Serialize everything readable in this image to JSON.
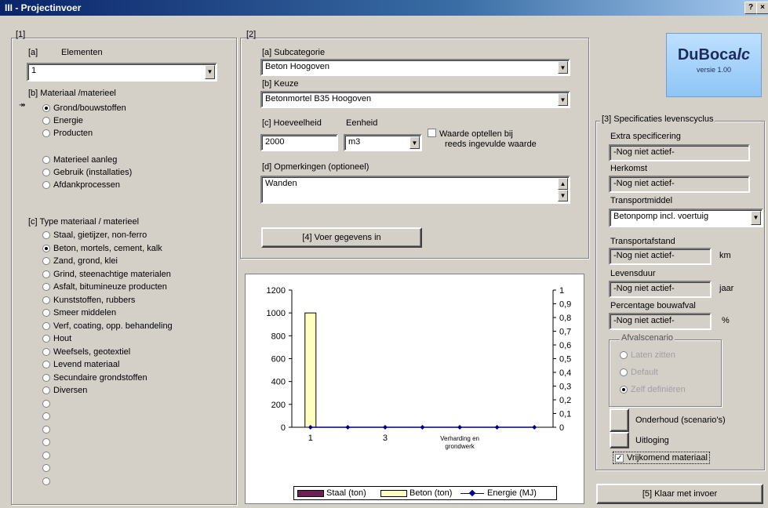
{
  "window": {
    "title": "III - Projectinvoer",
    "help_btn": "?",
    "close_btn": "×"
  },
  "left": {
    "section": "[1]",
    "elements": {
      "label_a": "[a]",
      "label": "Elementen",
      "value": "1"
    },
    "materiaal": {
      "label": "[b]  Materiaal /materieel",
      "options": [
        "Grond/bouwstoffen",
        "Energie",
        "Producten"
      ],
      "options2": [
        "Materieel aanleg",
        "Gebruik (installaties)",
        "Afdankprocessen"
      ],
      "selected": "Grond/bouwstoffen"
    },
    "type": {
      "label": "[c] Type materiaal / materieel",
      "options": [
        "Staal, gietijzer, non-ferro",
        "Beton, mortels, cement, kalk",
        "Zand, grond, klei",
        "Grind, steenachtige materialen",
        "Asfalt, bitumineuze producten",
        "Kunststoffen, rubbers",
        "Smeer middelen",
        "Verf, coating, opp. behandeling",
        "Hout",
        "Weefsels, geotextiel",
        "Levend materiaal",
        "Secundaire grondstoffen",
        "Diversen",
        "",
        "",
        "",
        "",
        "",
        "",
        ""
      ],
      "selected_index": 1
    }
  },
  "mid": {
    "section": "[2]",
    "subcategorie": {
      "label": "[a] Subcategorie",
      "value": "Beton Hoogoven"
    },
    "keuze": {
      "label": "[b] Keuze",
      "value": "Betonmortel B35 Hoogoven"
    },
    "hoeveelheid": {
      "label": "[c] Hoeveelheid",
      "value": "2000"
    },
    "eenheid": {
      "label": "Eenheid",
      "value": "m3"
    },
    "optellen": {
      "label1": "Waarde optellen bij",
      "label2": "reeds ingevulde waarde",
      "checked": false
    },
    "opmerkingen": {
      "label": "[d] Opmerkingen (optioneel)",
      "value": "Wanden"
    },
    "voer_in_button": "[4] Voer gegevens in"
  },
  "chart_data": {
    "type": "bar",
    "categories": [
      "1",
      "2",
      "3",
      "4",
      "5",
      "6",
      "7"
    ],
    "category_tick_labels": [
      "1",
      "",
      "3",
      "",
      "Verharding en\ngrondwerk",
      "",
      ""
    ],
    "series": [
      {
        "name": "Staal (ton)",
        "type": "bar",
        "axis": "left",
        "values": [
          0,
          0,
          0,
          0,
          0,
          0,
          0
        ],
        "color": "#6b1f56"
      },
      {
        "name": "Beton (ton)",
        "type": "bar",
        "axis": "left",
        "values": [
          1000,
          0,
          0,
          0,
          0,
          0,
          0
        ],
        "color": "#ffffc0"
      },
      {
        "name": "Energie (MJ)",
        "type": "line",
        "axis": "right",
        "values": [
          0,
          0,
          0,
          0,
          0,
          0,
          0
        ],
        "color": "#000080"
      }
    ],
    "ylim": [
      0,
      1200
    ],
    "yticks": [
      "0",
      "200",
      "400",
      "600",
      "800",
      "1000",
      "1200"
    ],
    "y2lim": [
      0,
      1
    ],
    "y2ticks": [
      "0",
      "0,1",
      "0,2",
      "0,3",
      "0,4",
      "0,5",
      "0,6",
      "0,7",
      "0,8",
      "0,9",
      "1"
    ],
    "legend_position": "bottom"
  },
  "right": {
    "logo_title_a": "DuBoca",
    "logo_title_b": "lc",
    "logo_version": "versie 1.00",
    "spec_label": "[3] Specificaties levenscyclus",
    "extra": {
      "label": "Extra specificering",
      "value": "-Nog niet actief-"
    },
    "herkomst": {
      "label": "Herkomst",
      "value": "-Nog niet actief-"
    },
    "transportmiddel": {
      "label": "Transportmiddel",
      "value": "Betonpomp incl. voertuig"
    },
    "transportafstand": {
      "label": "Transportafstand",
      "value": "-Nog niet actief-",
      "unit": "km"
    },
    "levensduur": {
      "label": "Levensduur",
      "value": "-Nog niet actief-",
      "unit": "jaar"
    },
    "bouwafval": {
      "label": "Percentage bouwafval",
      "value": "-Nog niet actief-",
      "unit": "%"
    },
    "afvalscenario": {
      "label": "Afvalscenario",
      "options": [
        "Laten zitten",
        "Default",
        "Zelf definiëren"
      ],
      "selected": 2
    },
    "onderhoud_button": "Onderhoud (scenario's)",
    "uitloging_button": "Uitloging",
    "vrijkomend": {
      "label": "Vrijkomend materiaal",
      "checked": true
    },
    "klaar_button": "[5] Klaar met invoer"
  }
}
